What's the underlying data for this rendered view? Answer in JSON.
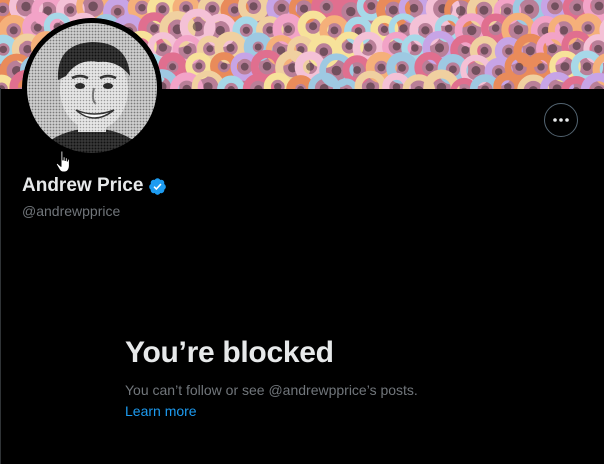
{
  "profile": {
    "display_name": "Andrew Price",
    "handle": "@andrewpprice",
    "verified": true,
    "banner_image": "colorful-cereal-rings-photo",
    "avatar_image": "grayscale-smiling-man-portrait"
  },
  "header": {
    "more_button_icon": "more-horizontal-icon"
  },
  "blocked": {
    "title": "You’re blocked",
    "description": "You can’t follow or see @andrewpprice’s posts.",
    "learn_more": "Learn more"
  },
  "colors": {
    "background": "#000000",
    "primary_text": "#e7e9ea",
    "secondary_text": "#71767b",
    "link": "#1d9bf0",
    "verified_badge": "#1d9bf0",
    "border": "#2f3336"
  }
}
